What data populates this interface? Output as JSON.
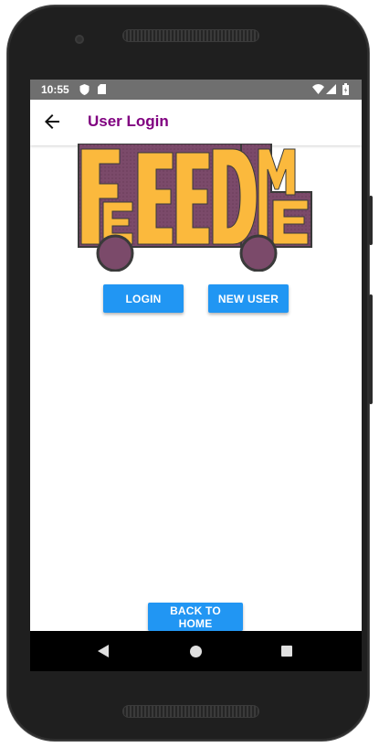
{
  "status_bar": {
    "time": "10:55",
    "icons": [
      "shield-icon",
      "sim-card-icon",
      "wifi-icon",
      "signal-icon",
      "battery-icon"
    ]
  },
  "app_bar": {
    "title": "User Login",
    "back_icon": "arrow-back-icon"
  },
  "logo": {
    "letters": [
      "F",
      "E",
      "E",
      "D",
      "M",
      "E"
    ]
  },
  "buttons": {
    "login": "LOGIN",
    "new_user": "NEW USER",
    "back_to_home": "BACK TO HOME"
  },
  "nav_bar": {
    "icons": [
      "back-triangle-icon",
      "home-circle-icon",
      "recents-square-icon"
    ]
  },
  "colors": {
    "title": "#800080",
    "button": "#2196f3",
    "logo_yellow": "#fbb93d",
    "logo_purple": "#7b4a6a"
  }
}
